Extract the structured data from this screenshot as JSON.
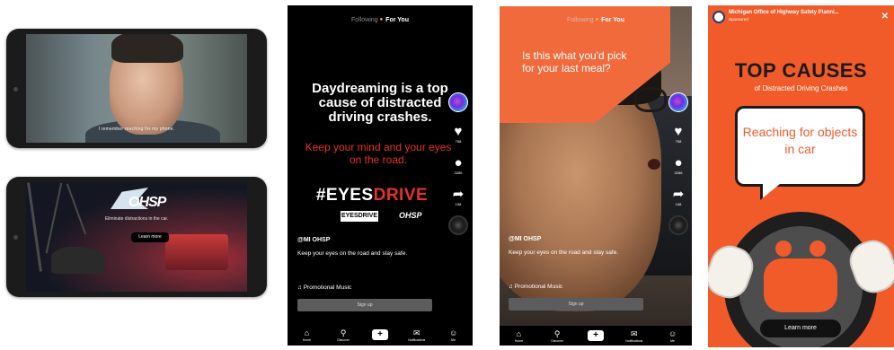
{
  "landscape_top": {
    "subtitle": "I remember reaching for my phone."
  },
  "landscape_bottom": {
    "logo_text": "OHSP",
    "caption": "Eliminate distractions in the car.",
    "button_label": "Learn more"
  },
  "tiktok_eyes": {
    "tabs": {
      "following": "Following",
      "for_you": "For You"
    },
    "headline": "Daydreaming is a top cause of distracted driving crashes.",
    "tagline": "Keep your mind and your eyes on the road.",
    "hashtag_prefix": "#EYES",
    "hashtag_suffix": "DRIVE",
    "mini_logo_left": "EYESDRIVE",
    "mini_logo_right": "OHSP",
    "counts": {
      "likes": "758",
      "comments": "3286",
      "shares": "158"
    },
    "handle": "@MI OHSP",
    "description": "Keep your eyes on the road and stay safe.",
    "music": "Promotional Music",
    "signup": "Sign up",
    "nav": [
      "Home",
      "Discover",
      "",
      "Notifications",
      "Me"
    ]
  },
  "tiktok_meal": {
    "tabs": {
      "following": "Following",
      "for_you": "For You"
    },
    "bubble_text": "Is this what you'd pick for your last meal?",
    "counts": {
      "likes": "758",
      "comments": "3286",
      "shares": "158"
    },
    "handle": "@MI OHSP",
    "description": "Keep your eyes on the road and stay safe.",
    "music": "Promotional Music",
    "signup": "Sign up",
    "nav": [
      "Home",
      "Discover",
      "",
      "Notifications",
      "Me"
    ]
  },
  "story_ad": {
    "account": "Michigan Office of Highway Safety Planni...",
    "sponsored": "Sponsored",
    "title": "TOP CAUSES",
    "subtitle": "of Distracted Driving Crashes",
    "card_text": "Reaching for objects in car",
    "button": "Learn more"
  },
  "colors": {
    "accent_red": "#e53227",
    "story_orange": "#f15a29"
  }
}
